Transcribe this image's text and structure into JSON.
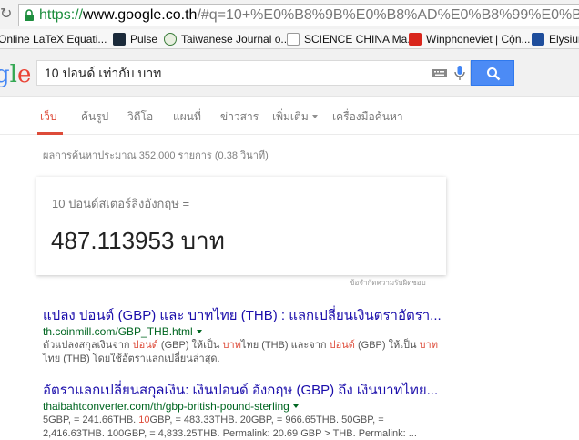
{
  "browser": {
    "url_scheme": "https://",
    "url_host": "www.google.co.th",
    "url_rest": "/#q=10+%E0%B8%9B%E0%B8%AD%E0%B8%99%E0%B8%94%E0%B8%94"
  },
  "bookmarks": [
    {
      "label": "Online LaTeX Equati...",
      "icon": "document-icon",
      "color": "#ffffff"
    },
    {
      "label": "Pulse",
      "icon": "pulse-icon",
      "color": "#1b2a3a"
    },
    {
      "label": "Taiwanese Journal o...",
      "icon": "journal-icon",
      "color": "#3b7d3b"
    },
    {
      "label": "SCIENCE CHINA Ma...",
      "icon": "document-icon",
      "color": "#ffffff"
    },
    {
      "label": "Winphoneviet | Cộn...",
      "icon": "winphoneviet-icon",
      "color": "#d9261c"
    },
    {
      "label": "Elysium",
      "icon": "hd-icon",
      "color": "#1f4e9c"
    }
  ],
  "search": {
    "logo_g": "g",
    "logo_l": "l",
    "logo_e": "e",
    "query": "10 ปอนด์ เท่ากับ บาท"
  },
  "tabs": [
    {
      "label": "เว็บ",
      "active": true
    },
    {
      "label": "ค้นรูป",
      "active": false
    },
    {
      "label": "วิดีโอ",
      "active": false
    },
    {
      "label": "แผนที่",
      "active": false
    },
    {
      "label": "ข่าวสาร",
      "active": false
    },
    {
      "label": "เพิ่มเติม",
      "active": false
    },
    {
      "label": "เครื่องมือค้นหา",
      "active": false
    }
  ],
  "stats": "ผลการค้นหาประมาณ 352,000 รายการ (0.38 วินาที)",
  "converter": {
    "question": "10 ปอนด์สเตอร์ลิงอังกฤษ =",
    "answer": "487.113953 บาท",
    "disclaimer": "ข้อจำกัดความรับผิดชอบ"
  },
  "results": [
    {
      "title": "แปลง ปอนด์ (GBP) และ บาทไทย (THB) : แลกเปลี่ยนเงินตราอัตรา...",
      "url": "th.coinmill.com/GBP_THB.html",
      "snippet1_a": "ตัวแปลงสกุลเงินจาก ",
      "snippet1_hl1": "ปอนด์",
      "snippet1_b": " (GBP) ให้เป็น ",
      "snippet1_hl2": "บาท",
      "snippet1_c": "ไทย (THB) และจาก ",
      "snippet1_hl3": "ปอนด์",
      "snippet1_d": " (GBP) ให้เป็น ",
      "snippet1_hl4": "บาท",
      "snippet2": "ไทย (THB) โดยใช้อัตราแลกเปลี่ยนล่าสุด."
    },
    {
      "title": "อัตราแลกเปลี่ยนสกุลเงิน: เงินปอนด์ อังกฤษ (GBP) ถึง เงินบาทไทย...",
      "url": "thaibahtconverter.com/th/gbp-british-pound-sterling",
      "snippet1_a": "5GBP, = 241.66THB. ",
      "snippet1_hl1": "10",
      "snippet1_b": "GBP, = 483.33THB. 20GBP, = 966.65THB. 50GBP, =",
      "snippet2": "2,416.63THB. 100GBP, = 4,833.25THB. Permalink: 20.69 GBP > THB. Permalink: ..."
    }
  ]
}
